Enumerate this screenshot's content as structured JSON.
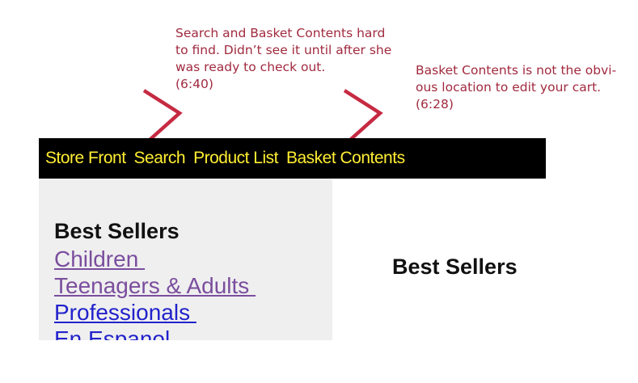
{
  "annotations": {
    "left_note": "Search and Basket Contents hard\nto find. Didn’t see it until after she\nwas ready to check out.\n(6:40)",
    "right_note": "Basket Contents is not the obvi-\nous location to edit your cart.\n(6:28)",
    "color": "#a12a3f"
  },
  "navbar": {
    "items": [
      {
        "label": "Store Front"
      },
      {
        "label": "Search"
      },
      {
        "label": "Product List"
      },
      {
        "label": "Basket Contents"
      }
    ],
    "background": "#000000",
    "text_color": "#ffee33"
  },
  "sidebar": {
    "title": "Best Sellers",
    "links": [
      {
        "label": "Children ",
        "state": "visited"
      },
      {
        "label": "Teenagers & Adults ",
        "state": "visited"
      },
      {
        "label": "Professionals ",
        "state": "unvisited"
      },
      {
        "label": "En Espanol",
        "state": "unvisited"
      }
    ],
    "background": "#efefef"
  },
  "main": {
    "title": "Best Sellers"
  }
}
